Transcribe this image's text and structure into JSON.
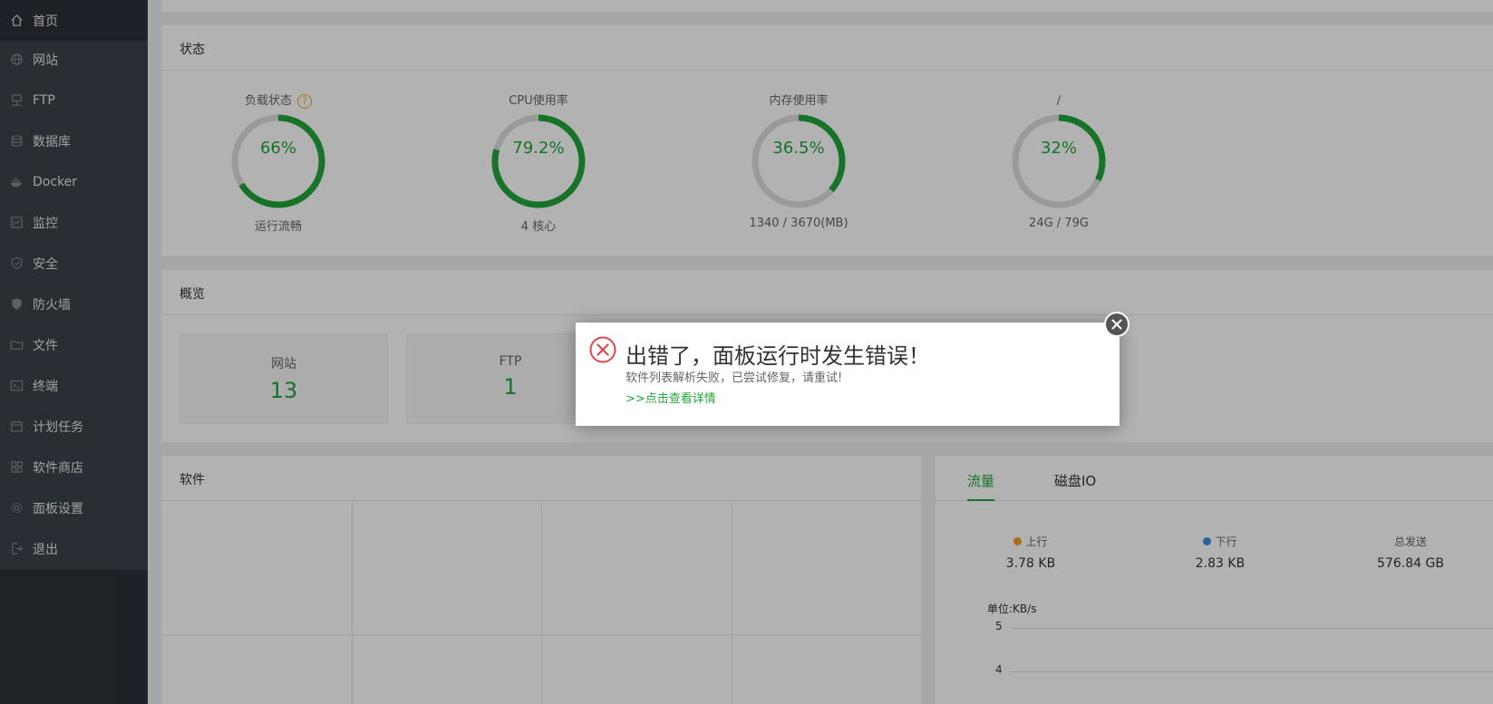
{
  "colors": {
    "accent": "#20a53a",
    "error": "#e0474c",
    "warning": "#f0a020",
    "upload": "#f0a020",
    "download": "#3a8ee6"
  },
  "sidebar": {
    "items": [
      {
        "label": "首页",
        "icon": "home-icon"
      },
      {
        "label": "网站",
        "icon": "globe-icon"
      },
      {
        "label": "FTP",
        "icon": "ftp-icon"
      },
      {
        "label": "数据库",
        "icon": "database-icon"
      },
      {
        "label": "Docker",
        "icon": "docker-icon"
      },
      {
        "label": "监控",
        "icon": "monitor-icon"
      },
      {
        "label": "安全",
        "icon": "shield-check-icon"
      },
      {
        "label": "防火墙",
        "icon": "firewall-shield-icon"
      },
      {
        "label": "文件",
        "icon": "folder-icon"
      },
      {
        "label": "终端",
        "icon": "terminal-icon"
      },
      {
        "label": "计划任务",
        "icon": "calendar-icon"
      },
      {
        "label": "软件商店",
        "icon": "apps-grid-icon"
      },
      {
        "label": "面板设置",
        "icon": "gear-icon"
      },
      {
        "label": "退出",
        "icon": "logout-icon"
      }
    ]
  },
  "status": {
    "title": "状态",
    "gauges": [
      {
        "title": "负载状态",
        "value": "66%",
        "percent": 66,
        "sub": "运行流畅",
        "help": "?"
      },
      {
        "title": "CPU使用率",
        "value": "79.2%",
        "percent": 79.2,
        "sub": "4 核心"
      },
      {
        "title": "内存使用率",
        "value": "36.5%",
        "percent": 36.5,
        "sub": "1340 / 3670(MB)"
      },
      {
        "title": "/",
        "value": "32%",
        "percent": 32,
        "sub": "24G / 79G"
      }
    ]
  },
  "overview": {
    "title": "概览",
    "cards": [
      {
        "label": "网站",
        "value": "13"
      },
      {
        "label": "FTP",
        "value": "1"
      }
    ]
  },
  "software": {
    "title": "软件"
  },
  "traffic": {
    "tabs": [
      "流量",
      "磁盘IO"
    ],
    "stats": [
      {
        "label": "上行",
        "value": "3.78 KB"
      },
      {
        "label": "下行",
        "value": "2.83 KB"
      },
      {
        "label": "总发送",
        "value": "576.84 GB"
      }
    ],
    "unit": "单位:KB/s",
    "ticks": [
      "5",
      "4"
    ]
  },
  "dialog": {
    "title": "出错了，面板运行时发生错误！",
    "message": "软件列表解析失败，已尝试修复，请重试!",
    "link": ">>点击查看详情"
  }
}
